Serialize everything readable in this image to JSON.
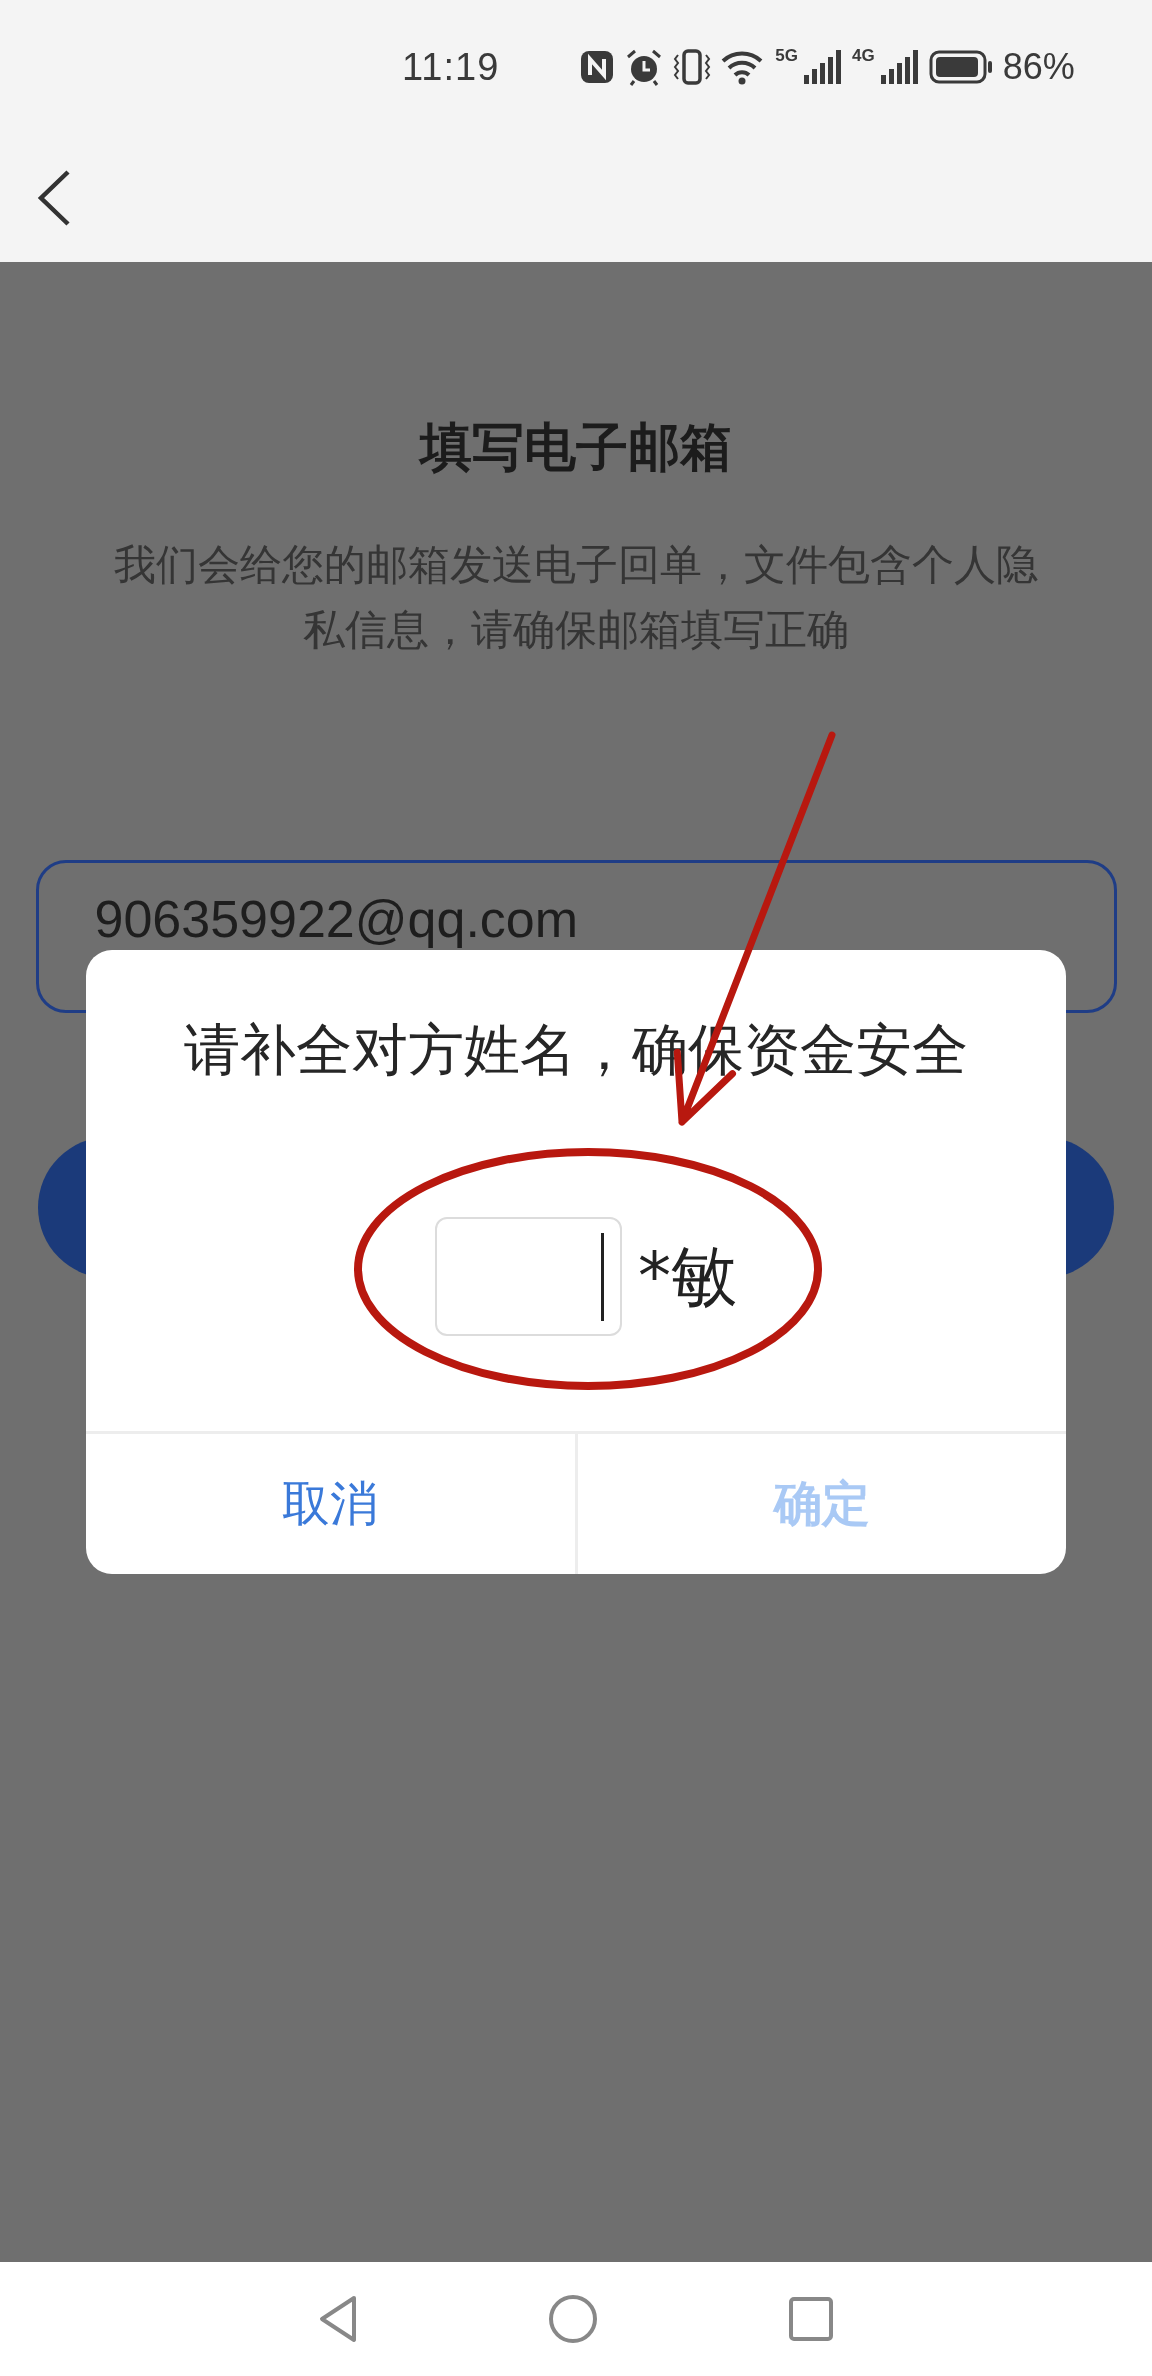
{
  "status_bar": {
    "time": "11:19",
    "network_1": "5G",
    "network_2": "4G",
    "battery": "86%"
  },
  "page": {
    "title": "填写电子邮箱",
    "description": "我们会给您的邮箱发送电子回单，文件包含个人隐私信息，请确保邮箱填写正确",
    "email": {
      "value": "906359922@qq.com"
    }
  },
  "dialog": {
    "message": "请补全对方姓名，确保资金安全",
    "name_suffix": "*敏",
    "buttons": [
      {
        "label": "取消",
        "disabled": false
      },
      {
        "label": "确定",
        "disabled": true
      }
    ]
  }
}
